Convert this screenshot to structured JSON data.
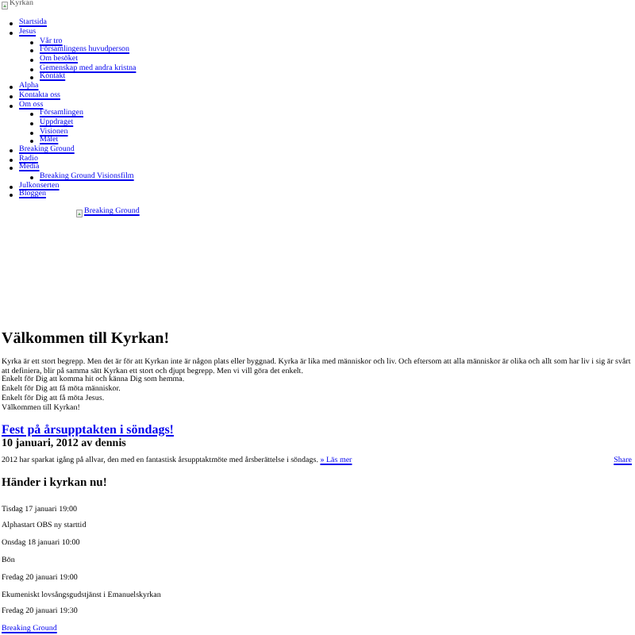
{
  "logo": {
    "alt": "Kyrkan"
  },
  "menu": [
    {
      "label": "Startsida"
    },
    {
      "label": "Jesus",
      "children": [
        {
          "label": "Vår tro"
        },
        {
          "label": "Församlingens huvudperson"
        },
        {
          "label": "Om besöket"
        },
        {
          "label": "Gemenskap med andra kristna"
        },
        {
          "label": "Kontakt"
        }
      ]
    },
    {
      "label": "Alpha"
    },
    {
      "label": "Kontakta oss"
    },
    {
      "label": "Om oss",
      "children": [
        {
          "label": "Församlingen"
        },
        {
          "label": "Uppdraget"
        },
        {
          "label": "Visionen"
        },
        {
          "label": "Målet"
        }
      ]
    },
    {
      "label": "Breaking Ground"
    },
    {
      "label": "Radio"
    },
    {
      "label": "Media",
      "children": [
        {
          "label": "Breaking Ground Visionsfilm"
        }
      ]
    },
    {
      "label": "Julkonserten"
    },
    {
      "label": "Bloggen"
    }
  ],
  "banner": {
    "alt": "Breaking Ground"
  },
  "welcome": {
    "heading": "Välkommen till Kyrkan!",
    "text": "Kyrka är ett stort begrepp. Men det är för att Kyrkan inte är någon plats eller byggnad. Kyrka är lika med människor och liv. Och eftersom att alla människor är olika och allt som har liv i sig är svårt att definiera, blir på samma sätt Kyrkan ett stort och djupt begrepp. Men vi vill göra det enkelt.",
    "lines": [
      "Enkelt för Dig att komma hit och känna Dig som hemma.",
      "Enkelt för Dig att få möta människor.",
      "Enkelt för Dig att få möta Jesus.",
      "Välkommen till Kyrkan!"
    ]
  },
  "post": {
    "title": "Fest på årsupptakten i söndags!",
    "meta": "10 januari, 2012 av dennis",
    "excerpt": "2012 har sparkat igång på allvar, den med en fantastisk årsupptaktmöte med årsberättelse i söndags.",
    "more": "» Läs mer",
    "share": "Share"
  },
  "events": {
    "heading": "Händer i kyrkan nu!",
    "items": [
      {
        "time": "Tisdag 17 januari 19:00",
        "title": "Alphastart OBS ny starttid"
      },
      {
        "time": "Onsdag 18 januari 10:00",
        "title": "Bön"
      },
      {
        "time": "Fredag 20 januari 19:00",
        "title": "Ekumeniskt lovsångsgudstjänst i Emanuelskyrkan"
      },
      {
        "time": "Fredag 20 januari 19:30"
      }
    ]
  },
  "footer_link": "Breaking Ground"
}
